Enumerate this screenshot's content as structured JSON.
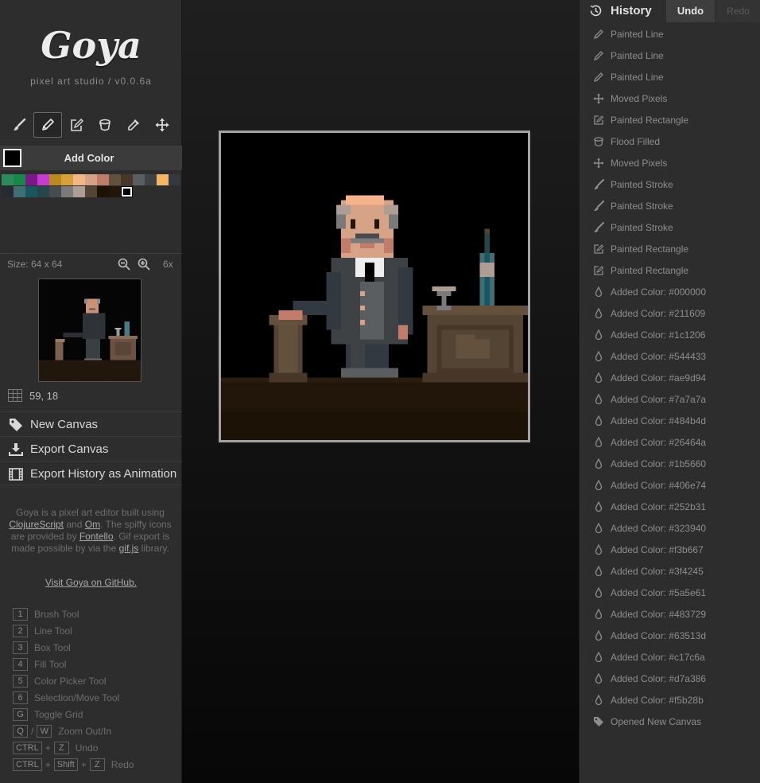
{
  "app": {
    "name": "Goya",
    "subtitle": "pixel art studio / v0.0.6a"
  },
  "tools": [
    {
      "name": "brush",
      "icon": "brush-icon",
      "active": false
    },
    {
      "name": "line",
      "icon": "pencil-icon",
      "active": true
    },
    {
      "name": "box",
      "icon": "edit-box-icon",
      "active": false
    },
    {
      "name": "fill",
      "icon": "bucket-icon",
      "active": false
    },
    {
      "name": "picker",
      "icon": "eyedropper-icon",
      "active": false
    },
    {
      "name": "move",
      "icon": "move-icon",
      "active": false
    }
  ],
  "palette": {
    "add_label": "Add Color",
    "current_color": "#000000",
    "row1": [
      "#2b8b5b",
      "#16894a",
      "#7a1a86",
      "#c73ad1",
      "#b98a23",
      "#d9a03a",
      "#f3b687",
      "#d7a386",
      "#c17c6a",
      "#63513d",
      "#483729",
      "#5a5e61",
      "#3f4245",
      "#f3b667",
      "#323940"
    ],
    "row2": [
      "#252b31",
      "#406e74",
      "#1b5660",
      "#26464a",
      "#484b4d",
      "#7a7a7a",
      "#ae9d94",
      "#544433",
      "#1c1206",
      "#211609",
      "#000000"
    ]
  },
  "size": {
    "label": "Size: 64 x 64",
    "zoom": "6x"
  },
  "cursor": {
    "coords": "59, 18"
  },
  "actions": {
    "new_canvas": "New Canvas",
    "export_canvas": "Export Canvas",
    "export_history": "Export History as Animation"
  },
  "about": {
    "t1": "Goya is a pixel art editor built using",
    "l1": "ClojureScript",
    "t2": "and",
    "l2": "Om",
    "t3": ". The spiffy icons are provided by",
    "l3": "Fontello",
    "t4": ". Gif export is made possible by via the",
    "l4": "gif.js",
    "t5": "library.",
    "visit": "Visit Goya on GitHub."
  },
  "shortcuts": [
    {
      "keys": [
        "1"
      ],
      "desc": "Brush Tool"
    },
    {
      "keys": [
        "2"
      ],
      "desc": "Line Tool"
    },
    {
      "keys": [
        "3"
      ],
      "desc": "Box Tool"
    },
    {
      "keys": [
        "4"
      ],
      "desc": "Fill Tool"
    },
    {
      "keys": [
        "5"
      ],
      "desc": "Color Picker Tool"
    },
    {
      "keys": [
        "6"
      ],
      "desc": "Selection/Move Tool"
    },
    {
      "keys": [
        "G"
      ],
      "desc": "Toggle Grid"
    },
    {
      "keys": [
        "Q",
        "W"
      ],
      "sep": "/",
      "desc": "Zoom Out/In"
    },
    {
      "keys": [
        "CTRL",
        "Z"
      ],
      "sep": "+",
      "desc": "Undo"
    },
    {
      "keys": [
        "CTRL",
        "Shift",
        "Z"
      ],
      "sep": "+",
      "desc": "Redo"
    }
  ],
  "history": {
    "title": "History",
    "undo": "Undo",
    "redo": "Redo",
    "items": [
      {
        "icon": "pencil-icon",
        "label": "Painted Line"
      },
      {
        "icon": "pencil-icon",
        "label": "Painted Line"
      },
      {
        "icon": "pencil-icon",
        "label": "Painted Line"
      },
      {
        "icon": "move-icon",
        "label": "Moved Pixels"
      },
      {
        "icon": "edit-box-icon",
        "label": "Painted Rectangle"
      },
      {
        "icon": "bucket-icon",
        "label": "Flood Filled"
      },
      {
        "icon": "move-icon",
        "label": "Moved Pixels"
      },
      {
        "icon": "brush-icon",
        "label": "Painted Stroke"
      },
      {
        "icon": "brush-icon",
        "label": "Painted Stroke"
      },
      {
        "icon": "brush-icon",
        "label": "Painted Stroke"
      },
      {
        "icon": "edit-box-icon",
        "label": "Painted Rectangle"
      },
      {
        "icon": "edit-box-icon",
        "label": "Painted Rectangle"
      },
      {
        "icon": "droplet-icon",
        "label": "Added Color: #000000"
      },
      {
        "icon": "droplet-icon",
        "label": "Added Color: #211609"
      },
      {
        "icon": "droplet-icon",
        "label": "Added Color: #1c1206"
      },
      {
        "icon": "droplet-icon",
        "label": "Added Color: #544433"
      },
      {
        "icon": "droplet-icon",
        "label": "Added Color: #ae9d94"
      },
      {
        "icon": "droplet-icon",
        "label": "Added Color: #7a7a7a"
      },
      {
        "icon": "droplet-icon",
        "label": "Added Color: #484b4d"
      },
      {
        "icon": "droplet-icon",
        "label": "Added Color: #26464a"
      },
      {
        "icon": "droplet-icon",
        "label": "Added Color: #1b5660"
      },
      {
        "icon": "droplet-icon",
        "label": "Added Color: #406e74"
      },
      {
        "icon": "droplet-icon",
        "label": "Added Color: #252b31"
      },
      {
        "icon": "droplet-icon",
        "label": "Added Color: #323940"
      },
      {
        "icon": "droplet-icon",
        "label": "Added Color: #f3b667"
      },
      {
        "icon": "droplet-icon",
        "label": "Added Color: #3f4245"
      },
      {
        "icon": "droplet-icon",
        "label": "Added Color: #5a5e61"
      },
      {
        "icon": "droplet-icon",
        "label": "Added Color: #483729"
      },
      {
        "icon": "droplet-icon",
        "label": "Added Color: #63513d"
      },
      {
        "icon": "droplet-icon",
        "label": "Added Color: #c17c6a"
      },
      {
        "icon": "droplet-icon",
        "label": "Added Color: #d7a386"
      },
      {
        "icon": "droplet-icon",
        "label": "Added Color: #f5b28b"
      },
      {
        "icon": "tag-icon",
        "label": "Opened New Canvas"
      }
    ]
  }
}
